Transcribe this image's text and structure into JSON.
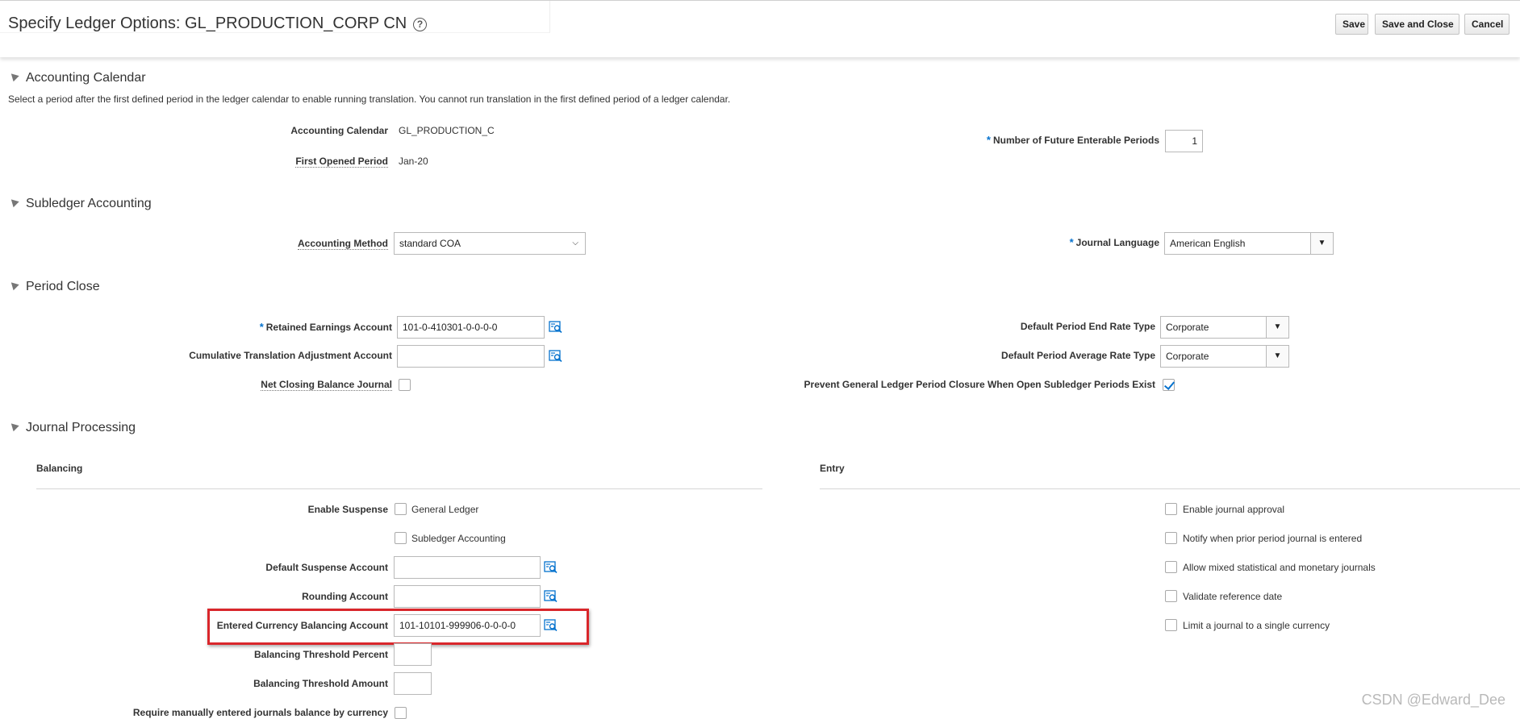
{
  "header": {
    "title": "Specify Ledger Options: GL_PRODUCTION_CORP CN",
    "help_icon": "?",
    "buttons": {
      "save": "Save",
      "save_and_close": "Save and Close",
      "cancel": "Cancel"
    }
  },
  "accounting_calendar": {
    "title": "Accounting Calendar",
    "instruction": "Select a period after the first defined period in the ledger calendar to enable running translation. You cannot run translation in the first defined period of a ledger calendar.",
    "calendar_label": "Accounting Calendar",
    "calendar_value": "GL_PRODUCTION_C",
    "first_period_label": "First Opened Period",
    "first_period_value": "Jan-20",
    "future_periods_label": "Number of Future Enterable Periods",
    "future_periods_value": "1",
    "required_mark": "*"
  },
  "subledger": {
    "title": "Subledger Accounting",
    "method_label": "Accounting Method",
    "method_value": "standard COA",
    "language_label": "Journal Language",
    "language_value": "American English",
    "required_mark": "*"
  },
  "period_close": {
    "title": "Period Close",
    "retained_label": "Retained Earnings Account",
    "retained_value": "101-0-410301-0-0-0-0",
    "cta_label": "Cumulative Translation Adjustment Account",
    "cta_value": "",
    "net_closing_label": "Net Closing Balance Journal",
    "end_rate_label": "Default Period End Rate Type",
    "end_rate_value": "Corporate",
    "avg_rate_label": "Default Period Average Rate Type",
    "avg_rate_value": "Corporate",
    "prevent_label": "Prevent General Ledger Period Closure When Open Subledger Periods Exist",
    "required_mark": "*"
  },
  "journal_processing": {
    "title": "Journal Processing",
    "balancing": {
      "title": "Balancing",
      "enable_suspense_label": "Enable Suspense",
      "general_ledger_label": "General Ledger",
      "subledger_label": "Subledger Accounting",
      "default_suspense_label": "Default Suspense Account",
      "default_suspense_value": "",
      "rounding_label": "Rounding Account",
      "rounding_value": "",
      "entered_currency_label": "Entered Currency Balancing Account",
      "entered_currency_value": "101-10101-999906-0-0-0-0",
      "threshold_percent_label": "Balancing Threshold Percent",
      "threshold_amount_label": "Balancing Threshold Amount",
      "require_manual_label": "Require manually entered journals balance by currency"
    },
    "entry": {
      "title": "Entry",
      "options": [
        "Enable journal approval",
        "Notify when prior period journal is entered",
        "Allow mixed statistical and monetary journals",
        "Validate reference date",
        "Limit a journal to a single currency"
      ]
    }
  },
  "watermark": "CSDN @Edward_Dee",
  "colors": {
    "accent": "#0572ce",
    "highlight": "#d9262b"
  }
}
